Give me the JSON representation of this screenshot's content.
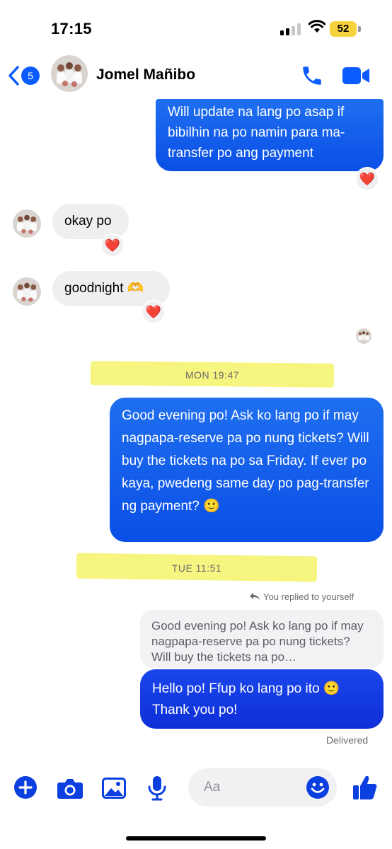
{
  "status": {
    "time": "17:15",
    "battery": "52"
  },
  "header": {
    "back_count": "5",
    "contact_name": "Jomel Mañibo"
  },
  "messages": {
    "m1": "Will update na lang po asap if bibilhin na po namin para ma-transfer po ang payment",
    "m2": "okay po",
    "m3": "goodnight 🫶",
    "m4": "Good evening po! Ask ko lang po if may nagpapa-reserve pa po nung tickets? Will buy the tickets na po sa Friday. If ever po kaya, pwedeng same day po pag-transfer ng payment? 🙂",
    "m5": "Hello po! Ffup ko lang po ito 🙂 Thank you po!"
  },
  "reactions": {
    "heart": "❤️"
  },
  "timestamps": {
    "t1": "MON 19:47",
    "t2": "TUE 11:51"
  },
  "reply": {
    "label": "You replied to yourself",
    "quote": "Good evening po! Ask ko lang po if may nagpapa-reserve pa po nung tickets? Will buy the tickets na po…"
  },
  "delivered": "Delivered",
  "composer": {
    "placeholder": "Aa"
  },
  "icons": [
    "back-chevron-icon",
    "phone-icon",
    "video-camera-icon",
    "plus-icon",
    "camera-icon",
    "gallery-icon",
    "microphone-icon",
    "emoji-icon",
    "thumbs-up-icon",
    "reply-arrow-icon"
  ],
  "colors": {
    "accent": "#0b5cff",
    "outgoing": "#1463ec",
    "incoming": "#efeff2"
  }
}
